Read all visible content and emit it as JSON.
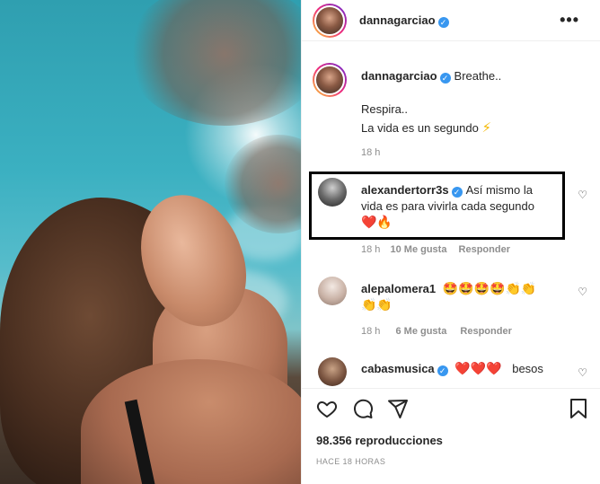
{
  "header": {
    "username": "dannagarciao",
    "more_label": "•••"
  },
  "caption": {
    "username": "dannagarciao",
    "text": "Breathe..",
    "line2": "Respira..",
    "line3": "La vida es un segundo",
    "line3_emoji": "⚡",
    "time": "18 h"
  },
  "comments": [
    {
      "username": "alexandertorr3s",
      "text_line1": "Así mismo la",
      "text_line2": "vida es para vivirla cada segundo",
      "emoji_line": "❤️🔥",
      "time": "18 h",
      "likes": "10 Me gusta",
      "reply": "Responder"
    },
    {
      "username": "alepalomera1",
      "emoji_line1": "🤩🤩🤩🤩👏👏",
      "emoji_line2": "👏👏",
      "time": "18 h",
      "likes": "6 Me gusta",
      "reply": "Responder"
    },
    {
      "username": "cabasmusica",
      "hearts": "❤️❤️❤️",
      "text": "besos"
    }
  ],
  "actions": {
    "views": "98.356 reproducciones",
    "time_ago": "HACE 18 HORAS"
  },
  "icons": {
    "like": "heart-icon",
    "comment": "comment-icon",
    "share": "send-icon",
    "save": "bookmark-icon"
  },
  "colors": {
    "verified": "#3897f0",
    "text": "#262626",
    "muted": "#8e8e8e",
    "heart": "#ed4956"
  }
}
